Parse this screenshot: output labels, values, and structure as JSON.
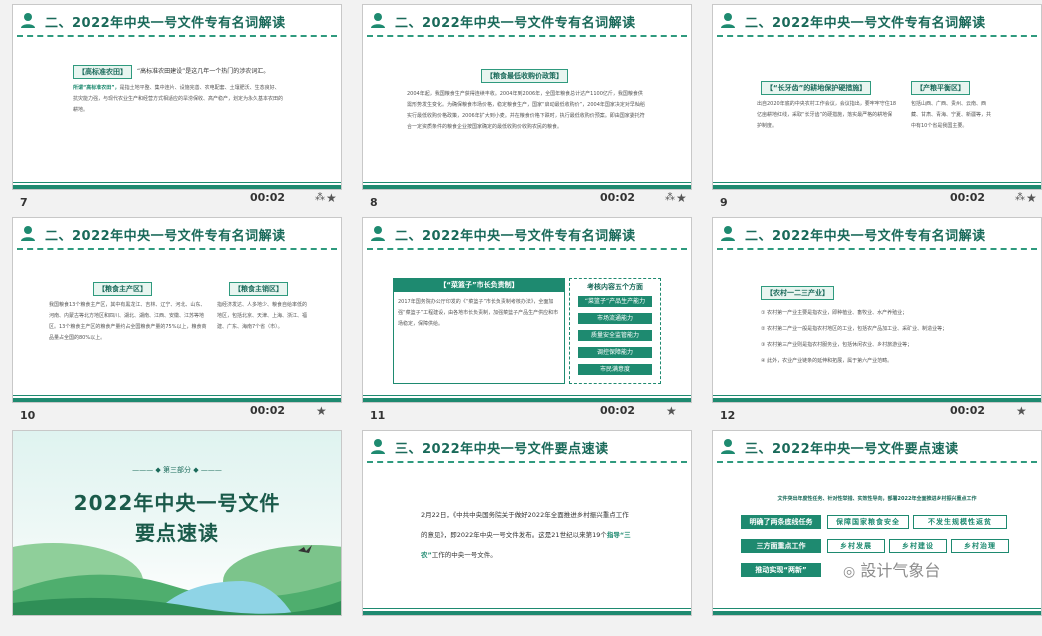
{
  "header_title_2": "二、2022年中央一号文件专有名词解读",
  "header_title_3": "三、2022年中央一号文件要点速读",
  "slide_time": "00:02",
  "slides": {
    "s7": {
      "num": "7",
      "tag": "【高标准农田】",
      "intro": "“高标准农田建设”是这几年一个热门的涉农词汇。",
      "body_hl": "所谓“高标准农田”，",
      "body": "是指土地平整、集中连片、设施完善、农电配套、土壤肥沃、生态良好、抗灾能力强，与现代农业生产和经营方式相适应的旱涝保收、高产稳产，划定为永久基本农田的耕地。"
    },
    "s8": {
      "num": "8",
      "tag": "【粮食最低收购价政策】",
      "body": "2004年起，我国粮食生产获得连续丰收。2004年到2006年，全国年粮食总计达产1100亿斤，我国粮食供需形势发生变化。为确保粮食市场价格，稳定粮食生产，国家“启动最低收购价”，2004年国家决定对早籼稻实行最低收购价格政策，2006年扩大到小麦。并在粮食价格下跌时，执行最低收购价预案。即由国家委托符合一定资质条件的粮食企业按国家确定的最低收购价收购农民的粮食。"
    },
    "s9": {
      "num": "9",
      "tag1": "【“长牙齿”的耕地保护硬措施】",
      "tag2": "【产粮平衡区】",
      "body1": "出自2020年底的中央农村工作会议，会议指出，要牢牢守住18亿亩耕地红线，采取“长牙齿”的硬措施，落实最严格的耕地保护制度。",
      "body2": "包括山西、广西、贵州、云南、西藏、甘肃、青海、宁夏、新疆等，共中有10个省是我国主要。"
    },
    "s10": {
      "num": "10",
      "tag1": "【粮食主产区】",
      "tag2": "【粮食主销区】",
      "body1": "我国粮食13个粮食主产区，其中有黑龙江、吉林、辽宁、河北、山东、河南、内蒙古等北方地区和四川、湖北、湖南、江西、安徽、江苏等地区。13个粮食主产区的粮食产量约占全国粮食产量的75%以上，粮食商品量占全国的80%以上。",
      "body2": "指经济发达、人多地少、粮食自给率低的地区，包括北京、天津、上海、浙江、福建、广东、海南7个省（市）。"
    },
    "s11": {
      "num": "11",
      "tag": "【“菜篮子”市长负责制】",
      "side_title": "考核内容五个方面",
      "body": "2017年国务院办公厅印发的《“菜篮子”市长负责制考核办法》，全面加强“菜篮子”工程建设，由各地市长负责制，加强菜篮子产品生产供应和市场稳定，保障供给。",
      "items": [
        "“菜篮子”产品生产能力",
        "市场流通能力",
        "质量安全监管能力",
        "调控保障能力",
        "市民满意度"
      ]
    },
    "s12": {
      "num": "12",
      "tag": "【农村一二三产业】",
      "lines": [
        "① 农村第一产业主要是指农业，即种植业、畜牧业、水产养殖业；",
        "② 农村第二产业一般是指农村地区的工业，包括农产品加工业、采矿业、制造业等；",
        "③ 农村第三产业则是指农村服务业，包括休闲农业、乡村旅游业等；",
        "④ 此外，农业产业链条的延伸和拓展，属于第六产业范畴。"
      ]
    },
    "s13": {
      "part": "第三部分",
      "title_line1": "2022年中央一号文件",
      "title_line2": "要点速读"
    },
    "s14": {
      "body_pre": "2月22日，《中共中央国务院关于做好2022年全面推进乡村振兴重点工作的意见》，即2022年中央一号文件发布。这是21世纪以来第19个",
      "body_hl": "指导“三农”",
      "body_post": "工作的中央一号文件。"
    },
    "s15": {
      "intro": "文件突出年度性任务、针对性举措、实效性导向，部署2022年全面推进乡村振兴重点工作",
      "row1_label": "明确了两条底线任务",
      "row1_items": [
        "保障国家粮食安全",
        "不发生规模性返贫"
      ],
      "row2_label": "三方面重点工作",
      "row2_items": [
        "乡村发展",
        "乡村建设",
        "乡村治理"
      ],
      "row3_label": "推动实现“两新”",
      "watermark": "設计气象台"
    }
  }
}
